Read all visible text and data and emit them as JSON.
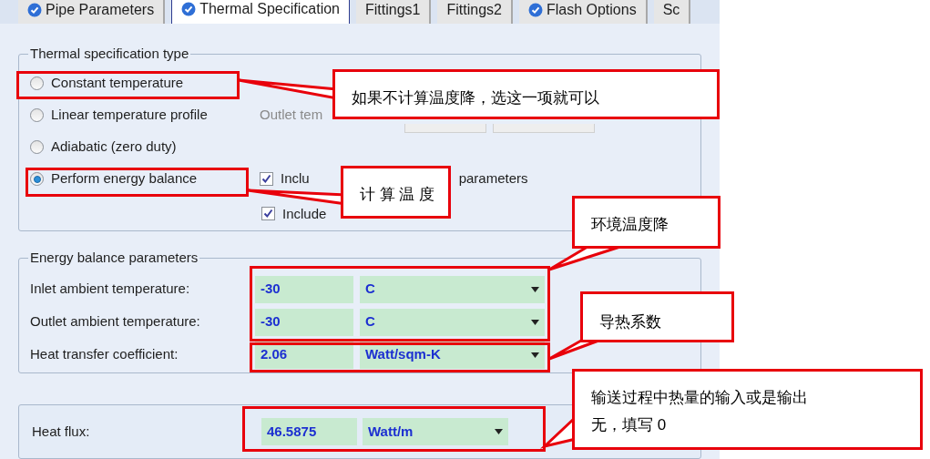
{
  "tabs": [
    {
      "label": "Pipe Parameters",
      "selected": false,
      "verified": true
    },
    {
      "label": "Thermal Specification",
      "selected": true,
      "verified": true
    },
    {
      "label": "Fittings1",
      "selected": false,
      "verified": false
    },
    {
      "label": "Fittings2",
      "selected": false,
      "verified": false
    },
    {
      "label": "Flash Options",
      "selected": false,
      "verified": true
    },
    {
      "label": "Sc",
      "selected": false,
      "verified": false
    }
  ],
  "thermal_specification": {
    "title": "Thermal specification type",
    "options": [
      {
        "label": "Constant temperature",
        "selected": false
      },
      {
        "label": "Linear temperature profile",
        "selected": false
      },
      {
        "label": "Adiabatic (zero duty)",
        "selected": false
      },
      {
        "label": "Perform energy balance",
        "selected": true
      }
    ],
    "outlet_label": "Outlet tem",
    "checkboxes": [
      {
        "label": "Inclu",
        "trailing": "parameters",
        "checked": true
      },
      {
        "label": "Include",
        "checked": true
      }
    ]
  },
  "energy_balance": {
    "title": "Energy balance parameters",
    "rows": [
      {
        "label": "Inlet ambient temperature:",
        "value": "-30",
        "unit": "C"
      },
      {
        "label": "Outlet ambient temperature:",
        "value": "-30",
        "unit": "C"
      },
      {
        "label": "Heat transfer coefficient:",
        "value": "2.06",
        "unit": "Watt/sqm-K"
      }
    ]
  },
  "heat_flux": {
    "label": "Heat flux:",
    "value": "46.5875",
    "unit": "Watt/m"
  },
  "annotations": [
    {
      "text": "如果不计算温度降，选这一项就可以"
    },
    {
      "text": "计 算 温 度"
    },
    {
      "text": "环境温度降"
    },
    {
      "text": "导热系数"
    },
    {
      "text": "输送过程中热量的输入或是输出无，填写 0"
    }
  ]
}
